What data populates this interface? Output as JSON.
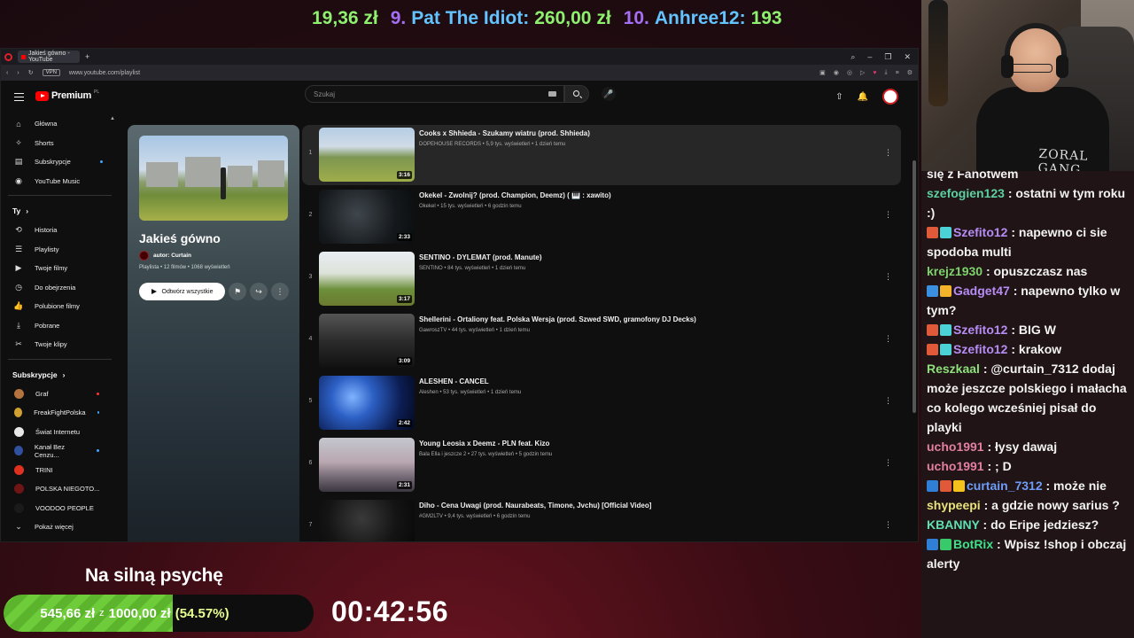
{
  "ticker": {
    "items": [
      {
        "num": "",
        "name": "",
        "amount": "19,36 zł"
      },
      {
        "num": "9.",
        "name": "Pat The Idiot:",
        "amount": "260,00 zł"
      },
      {
        "num": "10.",
        "name": "Anhree12:",
        "amount": "193"
      }
    ]
  },
  "browser": {
    "tab_title": "Jakieś gówno - YouTube",
    "url": "www.youtube.com/playlist",
    "vpn_label": "VPN"
  },
  "youtube": {
    "logo_text": "Premium",
    "logo_country": "PL",
    "search_placeholder": "Szukaj",
    "sidebar": {
      "main": [
        {
          "label": "Główna",
          "icon": "home-icon"
        },
        {
          "label": "Shorts",
          "icon": "shorts-icon"
        },
        {
          "label": "Subskrypcje",
          "icon": "subscriptions-icon"
        },
        {
          "label": "YouTube Music",
          "icon": "music-icon"
        }
      ],
      "you_header": "Ty",
      "you": [
        {
          "label": "Historia",
          "icon": "history-icon"
        },
        {
          "label": "Playlisty",
          "icon": "playlists-icon"
        },
        {
          "label": "Twoje filmy",
          "icon": "your-videos-icon"
        },
        {
          "label": "Do obejrzenia",
          "icon": "watch-later-icon"
        },
        {
          "label": "Polubione filmy",
          "icon": "liked-icon"
        },
        {
          "label": "Pobrane",
          "icon": "download-icon"
        },
        {
          "label": "Twoje klipy",
          "icon": "clips-icon"
        }
      ],
      "subs_header": "Subskrypcje",
      "subs": [
        {
          "label": "Graf",
          "color": "#b5733d",
          "dot": "red"
        },
        {
          "label": "FreakFightPolska",
          "color": "#d0a030",
          "dot": "blue"
        },
        {
          "label": "Świat Internetu",
          "color": "#e8e8e8",
          "dot": ""
        },
        {
          "label": "Kanał Bez Cenzu...",
          "color": "#3050a0",
          "dot": "blue"
        },
        {
          "label": "TRINI",
          "color": "#e03020",
          "dot": ""
        },
        {
          "label": "POLSKA NIEGOTO...",
          "color": "#701515",
          "dot": ""
        },
        {
          "label": "VOODOO PEOPLE",
          "color": "#1a1a1a",
          "dot": ""
        }
      ],
      "show_more": "Pokaż więcej"
    },
    "playlist": {
      "title": "Jakieś gówno",
      "author": "autor: Curtain",
      "meta": "Playlista • 12 filmów • 1068 wyświetleń",
      "play_all": "Odtwórz wszystkie"
    },
    "videos": [
      {
        "index": "1",
        "title": "Cooks x Shhieda - Szukamy wiatru (prod. Shhieda)",
        "channel": "DOPEHOUSE RECORDS",
        "meta": "5,9 tys. wyświetleń • 1 dzień temu",
        "duration": "3:16"
      },
      {
        "index": "2",
        "title": "Okekel - Zwolnij? (prod. Champion, Deemz) ( 🎹 : xawito)",
        "channel": "Okekel",
        "meta": "15 tys. wyświetleń • 6 godzin temu",
        "duration": "2:33"
      },
      {
        "index": "3",
        "title": "SENTINO - DYLEMAT (prod. Manute)",
        "channel": "SENTINO",
        "meta": "84 tys. wyświetleń • 1 dzień temu",
        "duration": "3:17"
      },
      {
        "index": "4",
        "title": "Shellerini - Ortaliony feat. Polska Wersja (prod. Szwed SWD, gramofony DJ Decks)",
        "channel": "GawroszTV",
        "meta": "44 tys. wyświetleń • 1 dzień temu",
        "duration": "3:09"
      },
      {
        "index": "5",
        "title": "ALESHEN - CANCEL",
        "channel": "Aleshen",
        "meta": "53 tys. wyświetleń • 1 dzień temu",
        "duration": "2:42"
      },
      {
        "index": "6",
        "title": "Young Leosia x Deemz - PLN feat. Kizo",
        "channel": "Bala Ella i jeszcze 2",
        "meta": "27 tys. wyświetleń • 5 godzin temu",
        "duration": "2:31"
      },
      {
        "index": "7",
        "title": "Diho - Cena Uwagi (prod. Naurabeats, Timone, Jvchu) [Official Video]",
        "channel": "#GM2LTV",
        "meta": "9,4 tys. wyświetleń • 6 godzin temu",
        "duration": ""
      }
    ]
  },
  "goal": {
    "label": "Na silną psychę",
    "current": "545,66 zł",
    "separator": "z",
    "target": "1000,00 zł",
    "percent_text": "(54.57%)",
    "fraction": 0.5457
  },
  "timer": "00:42:56",
  "webcam": {
    "hoodie_text": "ZORAL GANG"
  },
  "chat": {
    "messages": [
      {
        "nick": "",
        "text": "się z Fanotwem",
        "color": "#fff",
        "badges": []
      },
      {
        "nick": "szefogien123",
        "text": ": ostatni w tym roku :)",
        "color": "#5bd1a0",
        "badges": []
      },
      {
        "nick": "Szefito12",
        "text": ": napewno ci sie spodoba multi",
        "color": "#b68cf5",
        "badges": [
          "#e05a3a",
          "#4bd2d6"
        ]
      },
      {
        "nick": "krejz1930",
        "text": ": opuszczasz nas",
        "color": "#7dd36b",
        "badges": []
      },
      {
        "nick": "Gadget47",
        "text": ": napewno tylko w tym?",
        "color": "#b68cf5",
        "badges": [
          "#3b8fe0",
          "#f5b22b"
        ]
      },
      {
        "nick": "Szefito12",
        "text": ": BIG W",
        "color": "#b68cf5",
        "badges": [
          "#e05a3a",
          "#4bd2d6"
        ]
      },
      {
        "nick": "Szefito12",
        "text": ": krakow",
        "color": "#b68cf5",
        "badges": [
          "#e05a3a",
          "#4bd2d6"
        ]
      },
      {
        "nick": "Reszkaal",
        "text": ": @curtain_7312 dodaj może jeszcze polskiego i małacha co kolego wcześniej pisał do playki",
        "color": "#8ee07a",
        "badges": []
      },
      {
        "nick": "ucho1991",
        "text": ": łysy dawaj",
        "color": "#e27fa2",
        "badges": []
      },
      {
        "nick": "ucho1991",
        "text": ": ; D",
        "color": "#e27fa2",
        "badges": []
      },
      {
        "nick": "curtain_7312",
        "text": ": może nie",
        "color": "#6f9df5",
        "badges": [
          "#2f7fd6",
          "#e05a3a",
          "#f5c21b"
        ]
      },
      {
        "nick": "shypeepi",
        "text": ": a gdzie nowy sarius ?",
        "color": "#e8e27a",
        "badges": []
      },
      {
        "nick": "KBANNY",
        "text": ": do Eripe jedziesz?",
        "color": "#5fe0b0",
        "badges": []
      },
      {
        "nick": "BotRix",
        "text": ": Wpisz !shop i obczaj alerty",
        "color": "#3fe08a",
        "badges": [
          "#2f7fd6",
          "#38c96a"
        ]
      }
    ]
  }
}
